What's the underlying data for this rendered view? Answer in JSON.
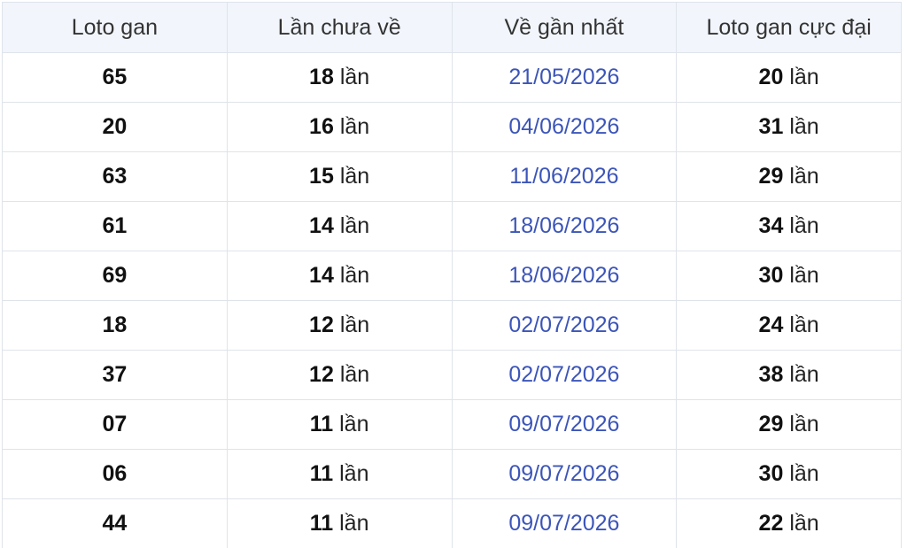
{
  "table": {
    "headers": [
      "Loto gan",
      "Lần chưa về",
      "Về gần nhất",
      "Loto gan cực đại"
    ],
    "unit": "lần",
    "rows": [
      {
        "loto": "65",
        "missed": "18",
        "last_date": "21/05/2026",
        "max_gan": "20"
      },
      {
        "loto": "20",
        "missed": "16",
        "last_date": "04/06/2026",
        "max_gan": "31"
      },
      {
        "loto": "63",
        "missed": "15",
        "last_date": "11/06/2026",
        "max_gan": "29"
      },
      {
        "loto": "61",
        "missed": "14",
        "last_date": "18/06/2026",
        "max_gan": "34"
      },
      {
        "loto": "69",
        "missed": "14",
        "last_date": "18/06/2026",
        "max_gan": "30"
      },
      {
        "loto": "18",
        "missed": "12",
        "last_date": "02/07/2026",
        "max_gan": "24"
      },
      {
        "loto": "37",
        "missed": "12",
        "last_date": "02/07/2026",
        "max_gan": "38"
      },
      {
        "loto": "07",
        "missed": "11",
        "last_date": "09/07/2026",
        "max_gan": "29"
      },
      {
        "loto": "06",
        "missed": "11",
        "last_date": "09/07/2026",
        "max_gan": "30"
      },
      {
        "loto": "44",
        "missed": "11",
        "last_date": "09/07/2026",
        "max_gan": "22"
      }
    ]
  }
}
